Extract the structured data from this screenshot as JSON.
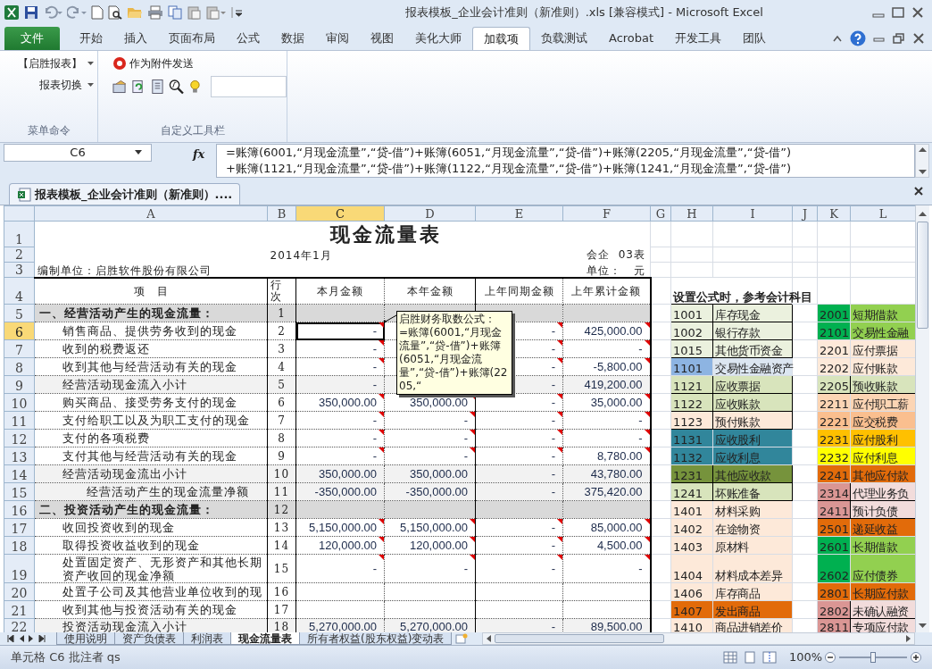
{
  "window": {
    "title": "报表模板_企业会计准则（新准则）.xls  [兼容模式] - Microsoft Excel"
  },
  "ribbon": {
    "tabs": [
      {
        "label": "文件",
        "kind": "file",
        "selected": false
      },
      {
        "label": "开始",
        "kind": "tab",
        "selected": false
      },
      {
        "label": "插入",
        "kind": "tab",
        "selected": false
      },
      {
        "label": "页面布局",
        "kind": "tab",
        "selected": false
      },
      {
        "label": "公式",
        "kind": "tab",
        "selected": false
      },
      {
        "label": "数据",
        "kind": "tab",
        "selected": false
      },
      {
        "label": "审阅",
        "kind": "tab",
        "selected": false
      },
      {
        "label": "视图",
        "kind": "tab",
        "selected": false
      },
      {
        "label": "美化大师",
        "kind": "tab",
        "selected": false
      },
      {
        "label": "加载项",
        "kind": "tab",
        "selected": true
      },
      {
        "label": "负载测试",
        "kind": "tab",
        "selected": false
      },
      {
        "label": "Acrobat",
        "kind": "tab",
        "selected": false
      },
      {
        "label": "开发工具",
        "kind": "tab",
        "selected": false
      },
      {
        "label": "团队",
        "kind": "tab",
        "selected": false
      }
    ],
    "groups": [
      {
        "label": "菜单命令",
        "items": [
          {
            "kind": "dropdown",
            "label": "【启胜报表】"
          },
          {
            "kind": "dropdown",
            "label": "报表切换"
          }
        ]
      },
      {
        "label": "自定义工具栏",
        "items": [
          {
            "kind": "button",
            "label": "作为附件发送"
          },
          {
            "kind": "icon_row"
          }
        ]
      }
    ]
  },
  "formula_bar": {
    "name_box": "C6",
    "function_label": "fx",
    "lines": [
      "=账簿(6001,“月现金流量”,“贷-借”)+账簿(6051,“月现金流量”,“贷-借”)+账簿(2205,“月现金流量”,“贷-借”)",
      "+账簿(1121,“月现金流量”,“贷-借”)+账簿(1122,“月现金流量”,“贷-借”)+账簿(1241,“月现金流量”,“贷-借”)"
    ]
  },
  "workbook_tab": "报表模板_企业会计准则（新准则）....",
  "sheet": {
    "columns": [
      {
        "label": "A",
        "selected": false
      },
      {
        "label": "B",
        "selected": false
      },
      {
        "label": "C",
        "selected": true
      },
      {
        "label": "D",
        "selected": false
      },
      {
        "label": "E",
        "selected": false
      },
      {
        "label": "F",
        "selected": false
      },
      {
        "label": "G",
        "selected": false
      },
      {
        "label": "H",
        "selected": false
      },
      {
        "label": "I",
        "selected": false
      },
      {
        "label": "J",
        "selected": false
      },
      {
        "label": "K",
        "selected": false
      },
      {
        "label": "L",
        "selected": false
      }
    ],
    "rows": [
      {
        "number": "1",
        "selected": false,
        "kind": "title",
        "c": "现金流量表"
      },
      {
        "number": "2",
        "selected": false,
        "kind": "period",
        "b": "2014年1月",
        "f": "会企  03表"
      },
      {
        "number": "3",
        "selected": false,
        "kind": "meta",
        "a": "编制单位：启胜软件股份有限公司",
        "f": "单位：   元"
      },
      {
        "number": "4",
        "selected": false,
        "kind": "header",
        "a": "项　目",
        "b": "行次",
        "c": "本月金额",
        "d": "本年金额",
        "e": "上年同期金额",
        "f": "上年累计金额",
        "h": "设置公式时，参考会计科目"
      },
      {
        "number": "5",
        "selected": false,
        "kind": "section",
        "a": "一、经营活动产生的现金流量：",
        "b": "1",
        "notes": false,
        "left": {
          "code": {
            "text": "1001",
            "color": "#ebf1de"
          },
          "name": {
            "text": "库存现金",
            "color": "#ebf1de"
          },
          "boxed": true
        },
        "right": {
          "code": {
            "text": "2001",
            "color": "#00b050"
          },
          "name": {
            "text": "短期借款",
            "color": "#92d050"
          },
          "boxed": false
        }
      },
      {
        "number": "6",
        "selected": true,
        "kind": "item",
        "a": "销售商品、提供劳务收到的现金",
        "b": "2",
        "c": "-",
        "e": "-",
        "f": "425,000.00",
        "notes": true,
        "left": {
          "code": {
            "text": "1002",
            "color": "#ebf1de"
          },
          "name": {
            "text": "银行存款",
            "color": "#ebf1de"
          },
          "boxed": true
        },
        "right": {
          "code": {
            "text": "2101",
            "color": "#00b050"
          },
          "name": {
            "text": "交易性金融",
            "color": "#92d050"
          },
          "boxed": false
        }
      },
      {
        "number": "7",
        "selected": false,
        "kind": "item",
        "a": "收到的税费返还",
        "b": "3",
        "c": "-",
        "e": "-",
        "f": "-",
        "notes": true,
        "left": {
          "code": {
            "text": "1015",
            "color": "#ebf1de"
          },
          "name": {
            "text": "其他货币资金",
            "color": "#ebf1de"
          },
          "boxed": true
        },
        "right": {
          "code": {
            "text": "2201",
            "color": "#fde9d9"
          },
          "name": {
            "text": "应付票据",
            "color": "#fde9d9"
          },
          "boxed": false
        }
      },
      {
        "number": "8",
        "selected": false,
        "kind": "item",
        "a": "收到其他与经营活动有关的现金",
        "b": "4",
        "c": "-",
        "e": "-",
        "f": "-5,800.00",
        "notes": true,
        "left": {
          "code": {
            "text": "1101",
            "color": "#8db4e2"
          },
          "name": {
            "text": "交易性金融资产",
            "color": "#dce6f1"
          },
          "boxed": false
        },
        "right": {
          "code": {
            "text": "2202",
            "color": "#fde9d9"
          },
          "name": {
            "text": "应付账款",
            "color": "#fde9d9"
          },
          "boxed": false
        }
      },
      {
        "number": "9",
        "selected": false,
        "kind": "subtotal",
        "a": "经营活动现金流入小计",
        "b": "5",
        "c": "-",
        "e": "-",
        "f": "419,200.00",
        "notes": false,
        "left": {
          "code": {
            "text": "1121",
            "color": "#d8e4bc"
          },
          "name": {
            "text": "应收票据",
            "color": "#d8e4bc"
          },
          "boxed": true
        },
        "right": {
          "code": {
            "text": "2205",
            "color": "#d8e4bc"
          },
          "name": {
            "text": "预收账款",
            "color": "#d8e4bc"
          },
          "boxed": true
        }
      },
      {
        "number": "10",
        "selected": false,
        "kind": "item",
        "a": "购买商品、接受劳务支付的现金",
        "b": "6",
        "c": "350,000.00",
        "d": "350,000.00",
        "e": "-",
        "f": "35,000.00",
        "notes": true,
        "left": {
          "code": {
            "text": "1122",
            "color": "#d8e4bc"
          },
          "name": {
            "text": "应收账款",
            "color": "#d8e4bc"
          },
          "boxed": true
        },
        "right": {
          "code": {
            "text": "2211",
            "color": "#fcd5b4"
          },
          "name": {
            "text": "应付职工薪",
            "color": "#fcd5b4"
          },
          "boxed": false
        }
      },
      {
        "number": "11",
        "selected": false,
        "kind": "item",
        "a": "支付给职工以及为职工支付的现金",
        "b": "7",
        "c": "-",
        "d": "-",
        "e": "-",
        "f": "-",
        "notes": true,
        "left": {
          "code": {
            "text": "1123",
            "color": "#fde9d9"
          },
          "name": {
            "text": "预付账款",
            "color": "#fde9d9"
          },
          "boxed": true
        },
        "right": {
          "code": {
            "text": "2221",
            "color": "#fabf8f"
          },
          "name": {
            "text": "应交税费",
            "color": "#fabf8f"
          },
          "boxed": false
        }
      },
      {
        "number": "12",
        "selected": false,
        "kind": "item",
        "a": "支付的各项税费",
        "b": "8",
        "c": "-",
        "d": "-",
        "e": "-",
        "f": "-",
        "notes": true,
        "left": {
          "code": {
            "text": "1131",
            "color": "#31869b"
          },
          "name": {
            "text": "应收股利",
            "color": "#31869b"
          },
          "boxed": false
        },
        "right": {
          "code": {
            "text": "2231",
            "color": "#ffc000"
          },
          "name": {
            "text": "应付股利",
            "color": "#ffc000"
          },
          "boxed": false
        }
      },
      {
        "number": "13",
        "selected": false,
        "kind": "item",
        "a": "支付其他与经营活动有关的现金",
        "b": "9",
        "c": "-",
        "d": "-",
        "e": "-",
        "f": "8,780.00",
        "notes": true,
        "left": {
          "code": {
            "text": "1132",
            "color": "#31869b"
          },
          "name": {
            "text": "应收利息",
            "color": "#31869b"
          },
          "boxed": false
        },
        "right": {
          "code": {
            "text": "2232",
            "color": "#ffff00"
          },
          "name": {
            "text": "应付利息",
            "color": "#ffff00"
          },
          "boxed": false
        }
      },
      {
        "number": "14",
        "selected": false,
        "kind": "subtotal",
        "a": "经营活动现金流出小计",
        "b": "10",
        "c": "350,000.00",
        "d": "350,000.00",
        "e": "-",
        "f": "43,780.00",
        "notes": false,
        "left": {
          "code": {
            "text": "1231",
            "color": "#76933c"
          },
          "name": {
            "text": "其他应收款",
            "color": "#76933c"
          },
          "boxed": true
        },
        "right": {
          "code": {
            "text": "2241",
            "color": "#e26b0a"
          },
          "name": {
            "text": "其他应付款",
            "color": "#e26b0a"
          },
          "boxed": false
        }
      },
      {
        "number": "15",
        "selected": false,
        "kind": "total",
        "a": "经营活动产生的现金流量净额",
        "b": "11",
        "c": "-350,000.00",
        "d": "-350,000.00",
        "e": "-",
        "f": "375,420.00",
        "notes": false,
        "left": {
          "code": {
            "text": "1241",
            "color": "#d8e4bc"
          },
          "name": {
            "text": "坏账准备",
            "color": "#d8e4bc"
          },
          "boxed": true
        },
        "right": {
          "code": {
            "text": "2314",
            "color": "#da9694"
          },
          "name": {
            "text": "代理业务负",
            "color": "#f2dcdb"
          },
          "boxed": true
        }
      },
      {
        "number": "16",
        "selected": false,
        "kind": "section",
        "a": "二、投资活动产生的现金流量：",
        "b": "12",
        "notes": false,
        "left": {
          "code": {
            "text": "1401",
            "color": "#fde9d9"
          },
          "name": {
            "text": "材料采购",
            "color": "#fde9d9"
          },
          "boxed": false
        },
        "right": {
          "code": {
            "text": "2411",
            "color": "#da9694"
          },
          "name": {
            "text": "预计负债",
            "color": "#f2dcdb"
          },
          "boxed": true
        }
      },
      {
        "number": "17",
        "selected": false,
        "kind": "item",
        "a": "收回投资收到的现金",
        "b": "13",
        "c": "5,150,000.00",
        "d": "5,150,000.00",
        "e": "-",
        "f": "85,000.00",
        "notes": true,
        "left": {
          "code": {
            "text": "1402",
            "color": "#fde9d9"
          },
          "name": {
            "text": "在途物资",
            "color": "#fde9d9"
          },
          "boxed": false
        },
        "right": {
          "code": {
            "text": "2501",
            "color": "#e26b0a"
          },
          "name": {
            "text": "递延收益",
            "color": "#e26b0a"
          },
          "boxed": false
        }
      },
      {
        "number": "18",
        "selected": false,
        "kind": "item",
        "a": "取得投资收益收到的现金",
        "b": "14",
        "c": "120,000.00",
        "d": "120,000.00",
        "e": "-",
        "f": "4,500.00",
        "notes": true,
        "left": {
          "code": {
            "text": "1403",
            "color": "#fde9d9"
          },
          "name": {
            "text": "原材料",
            "color": "#fde9d9"
          },
          "boxed": false
        },
        "right": {
          "code": {
            "text": "2601",
            "color": "#00b050"
          },
          "name": {
            "text": "长期借款",
            "color": "#92d050"
          },
          "boxed": false
        }
      },
      {
        "number": "19",
        "selected": false,
        "kind": "item",
        "a": "处置固定资产、无形资产和其他长期资产收回的现金净额",
        "b": "15",
        "c": "-",
        "d": "-",
        "e": "-",
        "f": "-",
        "notes": true,
        "left": {
          "code": {
            "text": "1404",
            "color": "#fde9d9"
          },
          "name": {
            "text": "材料成本差异",
            "color": "#fde9d9"
          },
          "boxed": false
        },
        "right": {
          "code": {
            "text": "2602",
            "color": "#00b050"
          },
          "name": {
            "text": "应付债券",
            "color": "#92d050"
          },
          "boxed": false
        }
      },
      {
        "number": "20",
        "selected": false,
        "kind": "item",
        "a": "处置子公司及其他营业单位收到的现",
        "b": "16",
        "notes": false,
        "left": {
          "code": {
            "text": "1406",
            "color": "#fde9d9"
          },
          "name": {
            "text": "库存商品",
            "color": "#fde9d9"
          },
          "boxed": false
        },
        "right": {
          "code": {
            "text": "2801",
            "color": "#e26b0a"
          },
          "name": {
            "text": "长期应付款",
            "color": "#e26b0a"
          },
          "boxed": false
        }
      },
      {
        "number": "21",
        "selected": false,
        "kind": "item",
        "a": "收到其他与投资活动有关的现金",
        "b": "17",
        "notes": false,
        "left": {
          "code": {
            "text": "1407",
            "color": "#e26b0a"
          },
          "name": {
            "text": "发出商品",
            "color": "#e26b0a"
          },
          "boxed": false
        },
        "right": {
          "code": {
            "text": "2802",
            "color": "#da9694"
          },
          "name": {
            "text": "未确认融资",
            "color": "#f2dcdb"
          },
          "boxed": true
        }
      },
      {
        "number": "22",
        "selected": false,
        "kind": "subtotal",
        "a": "投资活动现金流入小计",
        "b": "18",
        "c": "5,270,000.00",
        "d": "5,270,000.00",
        "e": "-",
        "f": "89,500.00",
        "notes": false,
        "left": {
          "code": {
            "text": "1410",
            "color": "#fde9d9"
          },
          "name": {
            "text": "商品进销差价",
            "color": "#fde9d9"
          },
          "boxed": false
        },
        "right": {
          "code": {
            "text": "2811",
            "color": "#da9694"
          },
          "name": {
            "text": "专项应付款",
            "color": "#f2dcdb"
          },
          "boxed": true
        }
      }
    ],
    "comment": "启胜财务取数公式：\n=账簿(6001,“月现金流量”,“贷-借”)+账簿(6051,“月现金流量”,“贷-借”)+账簿(2205,“"
  },
  "sheet_tabs": [
    {
      "label": "使用说明",
      "selected": false
    },
    {
      "label": "资产负债表",
      "selected": false
    },
    {
      "label": "利润表",
      "selected": false
    },
    {
      "label": "现金流量表",
      "selected": true
    },
    {
      "label": "所有者权益(股东权益)变动表",
      "selected": false
    }
  ],
  "status_bar": {
    "message": "单元格 C6 批注者 qs",
    "zoom": "100%",
    "level": 0.5
  }
}
